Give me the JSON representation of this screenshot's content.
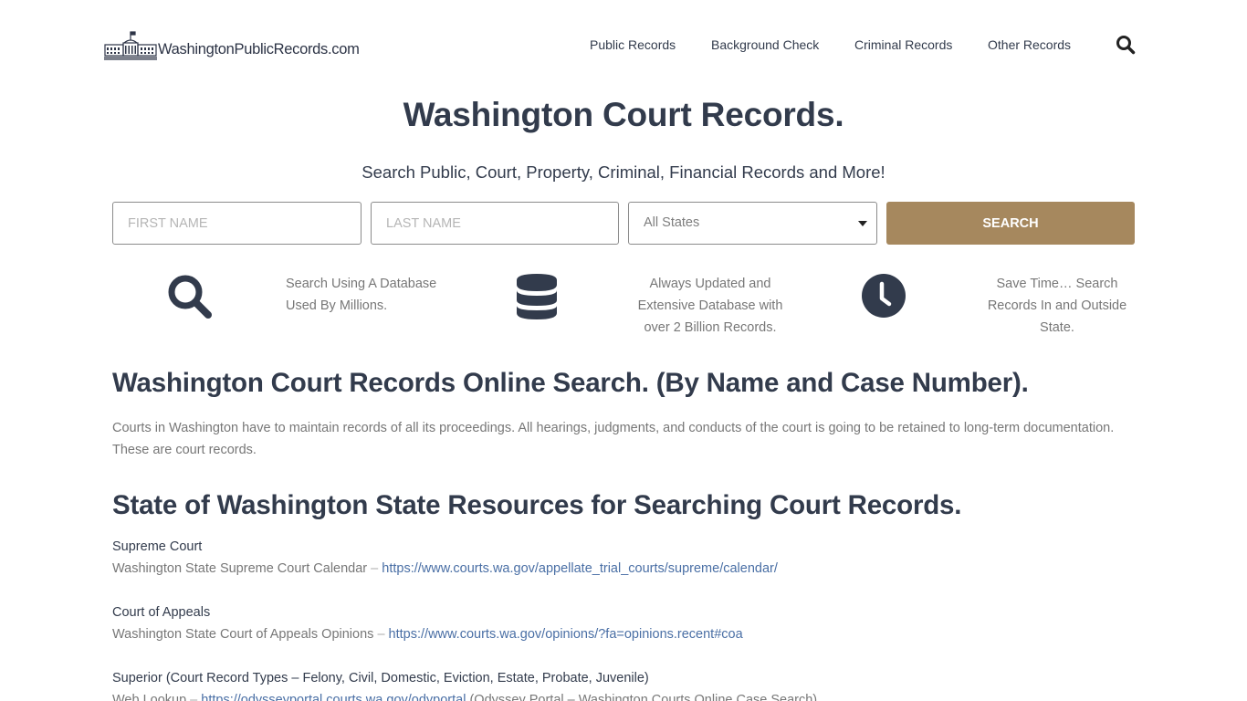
{
  "header": {
    "logo_text": "WashingtonPublicRecords.com",
    "nav": [
      {
        "label": "Public Records"
      },
      {
        "label": "Background Check"
      },
      {
        "label": "Criminal Records"
      },
      {
        "label": "Other Records"
      }
    ],
    "search_icon": "search-icon"
  },
  "hero": {
    "title": "Washington Court Records.",
    "subtitle": "Search Public, Court, Property, Criminal, Financial Records and More!"
  },
  "search_form": {
    "first_name_placeholder": "FIRST NAME",
    "last_name_placeholder": "LAST NAME",
    "state_selected": "All States",
    "search_label": "SEARCH",
    "button_color": "#a6885e"
  },
  "features": [
    {
      "icon": "search-icon",
      "text_lines": [
        "Search Using A Database",
        "Used By Millions."
      ]
    },
    {
      "icon": "database-icon",
      "text_lines": [
        "Always Updated and",
        "Extensive Database with",
        "over 2 Billion Records."
      ]
    },
    {
      "icon": "clock-icon",
      "text_lines": [
        "Save Time… Search",
        "Records In and Outside",
        "State."
      ]
    }
  ],
  "content": {
    "section1_title": "Washington Court Records Online Search. (By Name and Case Number).",
    "section1_text": "Courts in Washington have to maintain records of all its proceedings. All hearings, judgments, and conducts of the court is going to be retained to long-term documentation. These are court records.",
    "section2_title": "State of Washington State Resources for Searching Court Records.",
    "resources": [
      {
        "label": "Supreme Court",
        "desc": "Washington State Supreme Court Calendar",
        "separator": " – ",
        "link": "https://www.courts.wa.gov/appellate_trial_courts/supreme/calendar/",
        "suffix": ""
      },
      {
        "label": "Court of Appeals",
        "desc": "Washington State Court of Appeals Opinions",
        "separator": " – ",
        "link": "https://www.courts.wa.gov/opinions/?fa=opinions.recent#coa",
        "suffix": ""
      },
      {
        "label": "Superior (Court Record Types – Felony, Civil, Domestic, Eviction, Estate, Probate, Juvenile)",
        "desc": "Web Lookup",
        "separator": " – ",
        "link": "https://odysseyportal.courts.wa.gov/odyportal",
        "suffix": " (Odyssey Portal – Washington Courts Online Case Search)"
      }
    ]
  },
  "colors": {
    "text_dark": "#323b4c",
    "text_muted": "#777777",
    "link": "#4a6fa5",
    "accent": "#a6885e"
  }
}
